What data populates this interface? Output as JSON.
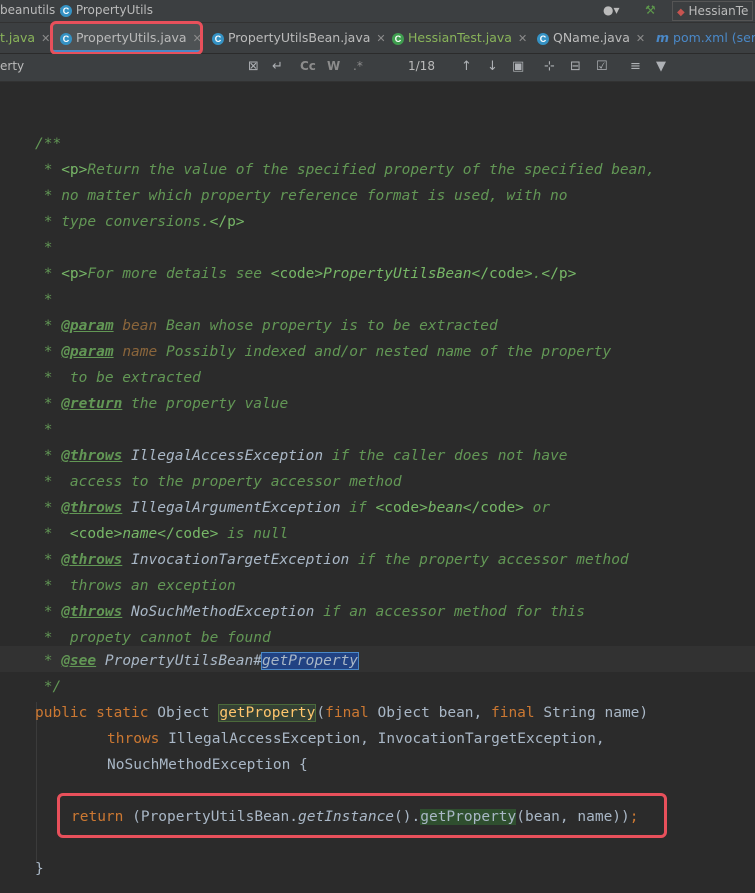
{
  "breadcrumb": {
    "package": "beanutils",
    "class": "PropertyUtils"
  },
  "toolbar": {
    "run_config": "HessianTe"
  },
  "tabs": [
    {
      "label": "t.java",
      "active": false
    },
    {
      "label": "PropertyUtils.java",
      "active": true
    },
    {
      "label": "PropertyUtilsBean.java",
      "active": false
    },
    {
      "label": "HessianTest.java",
      "active": false
    },
    {
      "label": "QName.java",
      "active": false
    },
    {
      "label": "pom.xml (seri",
      "active": false
    }
  ],
  "find": {
    "query": "erty",
    "case_label": "Cc",
    "word_label": "W",
    "regex_label": ".*",
    "match_count": "1/18"
  },
  "code": {
    "doc_open": "/**",
    "l1a": " * ",
    "l1tag1": "<p>",
    "l1text": "Return the value of the specified property of the specified bean,",
    "l2": " * no matter which property reference format is used, with no",
    "l3a": " * type conversions.",
    "l3tag": "</p>",
    "l4": " *",
    "l5a": " * ",
    "l5tag1": "<p>",
    "l5b": "For more details see ",
    "l5tag2": "<code>",
    "l5c": "PropertyUtilsBean",
    "l5tag3": "</code>",
    "l5d": ".",
    "l5tag4": "</p>",
    "l6": " *",
    "l7a": " * ",
    "l7at": "@param",
    "l7p": " bean",
    "l7b": " Bean whose property is to be extracted",
    "l8a": " * ",
    "l8at": "@param",
    "l8p": " name",
    "l8b": " Possibly indexed and/or nested name of the property",
    "l9": " *  to be extracted",
    "l10a": " * ",
    "l10at": "@return",
    "l10b": " the property value",
    "l11": " *",
    "l12a": " * ",
    "l12at": "@throws",
    "l12r": " IllegalAccessException",
    "l12b": " if the caller does not have",
    "l13": " *  access to the property accessor method",
    "l14a": " * ",
    "l14at": "@throws",
    "l14r": " IllegalArgumentException",
    "l14b": " if ",
    "l14t1": "<code>",
    "l14c": "bean",
    "l14t2": "</code>",
    "l14d": " or",
    "l15a": " *  ",
    "l15t1": "<code>",
    "l15c": "name",
    "l15t2": "</code>",
    "l15d": " is null",
    "l16a": " * ",
    "l16at": "@throws",
    "l16r": " InvocationTargetException",
    "l16b": " if the property accessor method",
    "l17": " *  throws an exception",
    "l18a": " * ",
    "l18at": "@throws",
    "l18r": " NoSuchMethodException",
    "l18b": " if an accessor method for this",
    "l19": " *  propety cannot be found",
    "l20a": " * ",
    "l20at": "@see",
    "l20r": " PropertyUtilsBean#",
    "l20sel": "getProperty",
    "doc_close": " */",
    "sig_public": "public",
    "sig_static": " static",
    "sig_obj": " Object ",
    "sig_method": "getProperty",
    "sig_paren": "(",
    "sig_final1": "final",
    "sig_p1": " Object bean, ",
    "sig_final2": "final",
    "sig_p2": " String name)",
    "throws_kw": "throws",
    "throws_list": " IllegalAccessException, InvocationTargetException,",
    "throws_cont": "NoSuchMethodException {",
    "ret_kw": "return",
    "ret_a": " (PropertyUtilsBean.",
    "ret_static": "getInstance",
    "ret_b": "().",
    "ret_method": "getProperty",
    "ret_c": "(bean, name))",
    "ret_semi": ";",
    "close": "}"
  },
  "colors": {
    "keyword": "#cc7832",
    "javadoc": "#629755",
    "method": "#ffc66d",
    "text": "#a9b7c6",
    "background": "#2b2b2b",
    "annotation_box": "#e8505b"
  }
}
